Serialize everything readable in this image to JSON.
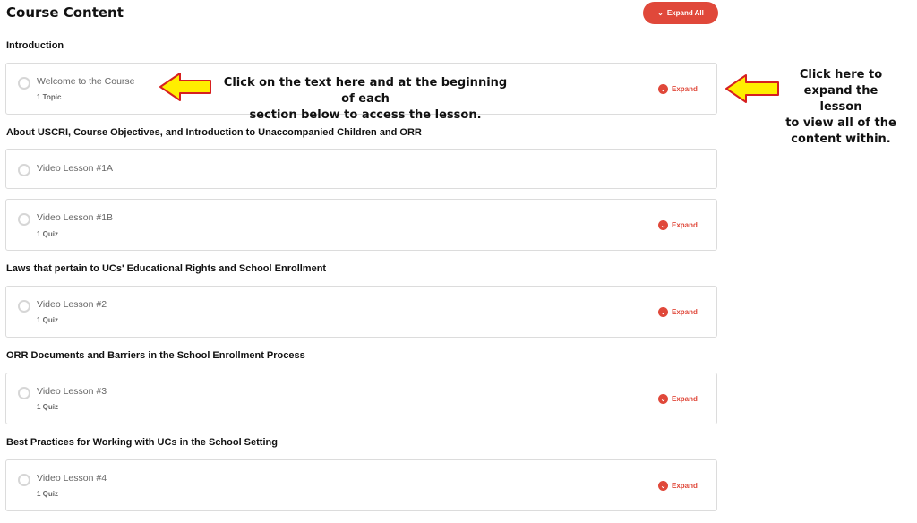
{
  "header": {
    "title": "Course Content",
    "expand_all_label": "Expand All"
  },
  "sections": [
    {
      "title": "Introduction",
      "lessons": [
        {
          "name": "Welcome to the Course",
          "meta": "1 Topic",
          "expand_label": "Expand"
        }
      ]
    },
    {
      "title": "About USCRI, Course Objectives, and Introduction to Unaccompanied Children and ORR",
      "lessons": [
        {
          "name": "Video Lesson #1A"
        },
        {
          "name": "Video Lesson #1B",
          "meta": "1 Quiz",
          "expand_label": "Expand"
        }
      ]
    },
    {
      "title": "Laws that pertain to UCs' Educational Rights and School Enrollment",
      "lessons": [
        {
          "name": "Video Lesson #2",
          "meta": "1 Quiz",
          "expand_label": "Expand"
        }
      ]
    },
    {
      "title": "ORR Documents and Barriers in the School Enrollment Process",
      "lessons": [
        {
          "name": "Video Lesson #3",
          "meta": "1 Quiz",
          "expand_label": "Expand"
        }
      ]
    },
    {
      "title": "Best Practices for Working with UCs in the School Setting",
      "lessons": [
        {
          "name": "Video Lesson #4",
          "meta": "1 Quiz",
          "expand_label": "Expand"
        }
      ]
    }
  ],
  "annotations": {
    "center_line1": "Click on the text here and at the beginning of each",
    "center_line2": "section below to access the lesson.",
    "right_line1": "Click here to",
    "right_line2": "expand the lesson",
    "right_line3": "to view all of the",
    "right_line4": "content within."
  },
  "colors": {
    "accent": "#e0483a",
    "arrow_fill": "#ffee00",
    "arrow_stroke": "#d62020"
  },
  "icons": {
    "expand_all": "chevron-down-icon",
    "expand": "chevron-down-circle-icon",
    "lesson_status": "empty-circle-icon",
    "pointer": "arrow-left-icon"
  }
}
